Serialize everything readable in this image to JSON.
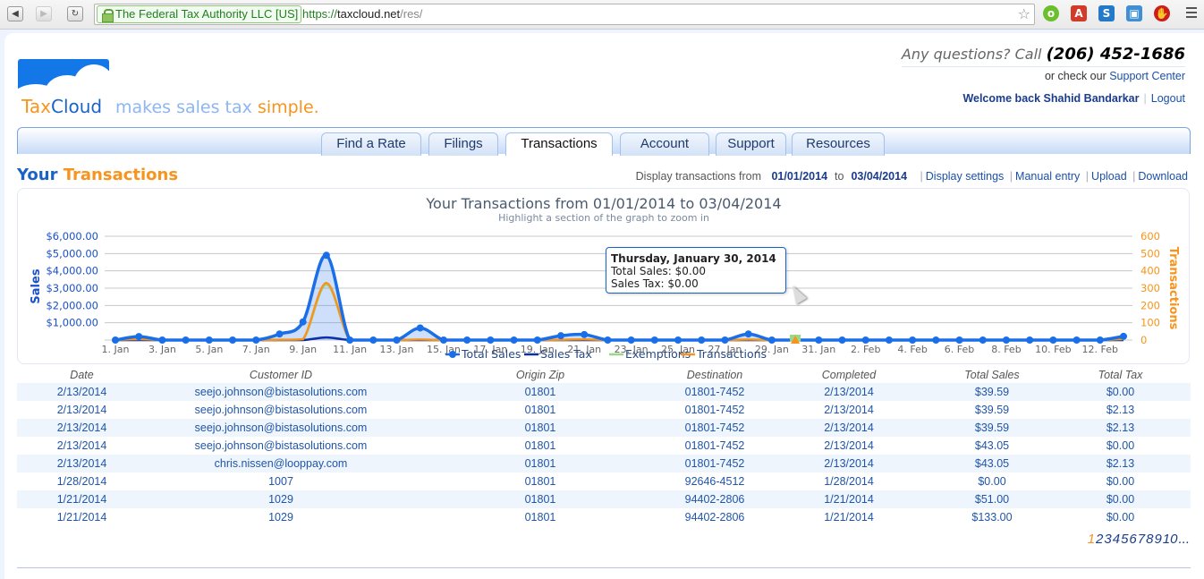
{
  "browser": {
    "ev_label": "The Federal Tax Authority LLC [US]",
    "url_scheme": "https://",
    "url_host": "taxcloud.net",
    "url_path": "/res/"
  },
  "brand": {
    "tax": "Tax",
    "cloud": "Cloud",
    "tagline_prefix": "makes sales tax ",
    "tagline_emph": "simple."
  },
  "header": {
    "questions": "Any questions? Call ",
    "phone": "(206) 452-1686",
    "support_prefix": "or check our ",
    "support_link": "Support Center",
    "welcome": "Welcome back Shahid Bandarkar",
    "logout": "Logout"
  },
  "tabs": [
    {
      "label": "Find a Rate"
    },
    {
      "label": "Filings"
    },
    {
      "label": "Transactions",
      "active": true
    },
    {
      "label": "Account"
    },
    {
      "label": "Support"
    },
    {
      "label": "Resources"
    }
  ],
  "section": {
    "title_a": "Your ",
    "title_b": "Transactions",
    "range_prefix": "Display transactions from",
    "from": "01/01/2014",
    "to_label": "to",
    "to": "03/04/2014",
    "links": [
      "Display settings",
      "Manual entry",
      "Upload",
      "Download"
    ]
  },
  "tooltip": {
    "title": "Thursday, January 30, 2014",
    "line1": "Total Sales: $0.00",
    "line2": "Sales Tax: $0.00"
  },
  "chart_data": {
    "type": "area",
    "title": "Your Transactions from 01/01/2014 to 03/04/2014",
    "subtitle": "Highlight a section of the graph to zoom in",
    "ylabel": "Sales",
    "ylabel_right": "Transactions",
    "ylim": [
      0,
      6000
    ],
    "ylim_right": [
      0,
      600
    ],
    "yticks": [
      "$1,000.00",
      "$2,000.00",
      "$3,000.00",
      "$4,000.00",
      "$5,000.00",
      "$6,000.00"
    ],
    "yticks_right": [
      "0",
      "100",
      "200",
      "300",
      "400",
      "500",
      "600"
    ],
    "xticks": [
      "1. Jan",
      "3. Jan",
      "5. Jan",
      "7. Jan",
      "9. Jan",
      "11. Jan",
      "13. Jan",
      "15. Jan",
      "17. Jan",
      "19. Jan",
      "21. Jan",
      "23. Jan",
      "25. Jan",
      "27. Jan",
      "29. Jan",
      "31. Jan",
      "2. Feb",
      "4. Feb",
      "6. Feb",
      "8. Feb",
      "10. Feb",
      "12. Feb"
    ],
    "x": [
      "Jan 1",
      "Jan 2",
      "Jan 3",
      "Jan 4",
      "Jan 5",
      "Jan 6",
      "Jan 7",
      "Jan 8",
      "Jan 9",
      "Jan 10",
      "Jan 11",
      "Jan 12",
      "Jan 13",
      "Jan 14",
      "Jan 15",
      "Jan 16",
      "Jan 17",
      "Jan 18",
      "Jan 19",
      "Jan 20",
      "Jan 21",
      "Jan 22",
      "Jan 23",
      "Jan 24",
      "Jan 25",
      "Jan 26",
      "Jan 27",
      "Jan 28",
      "Jan 29",
      "Jan 30",
      "Jan 31",
      "Feb 1",
      "Feb 2",
      "Feb 3",
      "Feb 4",
      "Feb 5",
      "Feb 6",
      "Feb 7",
      "Feb 8",
      "Feb 9",
      "Feb 10",
      "Feb 11",
      "Feb 12",
      "Feb 13"
    ],
    "series": [
      {
        "name": "Total Sales",
        "color": "#1a6fe8",
        "axis": "left",
        "values": [
          0,
          200,
          0,
          0,
          0,
          0,
          0,
          350,
          1050,
          4900,
          0,
          0,
          0,
          700,
          0,
          0,
          0,
          0,
          0,
          250,
          320,
          0,
          0,
          0,
          0,
          0,
          0,
          350,
          0,
          0,
          0,
          0,
          0,
          0,
          0,
          0,
          0,
          0,
          0,
          0,
          0,
          0,
          0,
          215
        ]
      },
      {
        "name": "Sales Tax",
        "color": "#0a2fa8",
        "axis": "left",
        "values": [
          0,
          0,
          0,
          0,
          0,
          0,
          0,
          0,
          0,
          150,
          0,
          0,
          0,
          0,
          0,
          0,
          0,
          0,
          0,
          0,
          0,
          0,
          0,
          0,
          0,
          0,
          0,
          0,
          0,
          0,
          0,
          0,
          0,
          0,
          0,
          0,
          0,
          0,
          0,
          0,
          0,
          0,
          0,
          2
        ]
      },
      {
        "name": "Exemptions",
        "color": "#9ad78a",
        "axis": "left",
        "values": [
          0,
          0,
          0,
          0,
          0,
          0,
          0,
          0,
          0,
          3200,
          0,
          0,
          0,
          0,
          0,
          0,
          0,
          0,
          0,
          0,
          0,
          0,
          0,
          0,
          0,
          0,
          0,
          0,
          0,
          0,
          0,
          0,
          0,
          0,
          0,
          0,
          0,
          0,
          0,
          0,
          0,
          0,
          0,
          0
        ]
      },
      {
        "name": "Transactions",
        "color": "#f7941d",
        "axis": "right",
        "values": [
          0,
          5,
          0,
          0,
          0,
          0,
          0,
          2,
          5,
          330,
          0,
          0,
          0,
          3,
          0,
          0,
          0,
          0,
          0,
          2,
          4,
          0,
          0,
          0,
          0,
          0,
          0,
          3,
          0,
          0,
          0,
          0,
          0,
          0,
          0,
          0,
          0,
          0,
          0,
          0,
          0,
          0,
          0,
          6
        ]
      }
    ],
    "legend": [
      "Total Sales",
      "Sales Tax",
      "Exemptions",
      "Transactions"
    ],
    "legend_position": "bottom",
    "grid": true
  },
  "table": {
    "columns": [
      "Date",
      "Customer ID",
      "Origin Zip",
      "Destination",
      "Completed",
      "Total Sales",
      "Total Tax"
    ],
    "rows": [
      [
        "2/13/2014",
        "seejo.johnson@bistasolutions.com",
        "01801",
        "01801-7452",
        "2/13/2014",
        "$39.59",
        "$0.00"
      ],
      [
        "2/13/2014",
        "seejo.johnson@bistasolutions.com",
        "01801",
        "01801-7452",
        "2/13/2014",
        "$39.59",
        "$2.13"
      ],
      [
        "2/13/2014",
        "seejo.johnson@bistasolutions.com",
        "01801",
        "01801-7452",
        "2/13/2014",
        "$39.59",
        "$2.13"
      ],
      [
        "2/13/2014",
        "seejo.johnson@bistasolutions.com",
        "01801",
        "01801-7452",
        "2/13/2014",
        "$43.05",
        "$0.00"
      ],
      [
        "2/13/2014",
        "chris.nissen@looppay.com",
        "01801",
        "01801-7452",
        "2/13/2014",
        "$43.05",
        "$2.13"
      ],
      [
        "1/28/2014",
        "1007",
        "01801",
        "92646-4512",
        "1/28/2014",
        "$0.00",
        "$0.00"
      ],
      [
        "1/21/2014",
        "1029",
        "01801",
        "94402-2806",
        "1/21/2014",
        "$51.00",
        "$0.00"
      ],
      [
        "1/21/2014",
        "1029",
        "01801",
        "94402-2806",
        "1/21/2014",
        "$133.00",
        "$0.00"
      ]
    ]
  },
  "pager": {
    "current": "1",
    "pages": [
      "2",
      "3",
      "4",
      "5",
      "6",
      "7",
      "8",
      "9",
      "10"
    ],
    "more": "..."
  }
}
